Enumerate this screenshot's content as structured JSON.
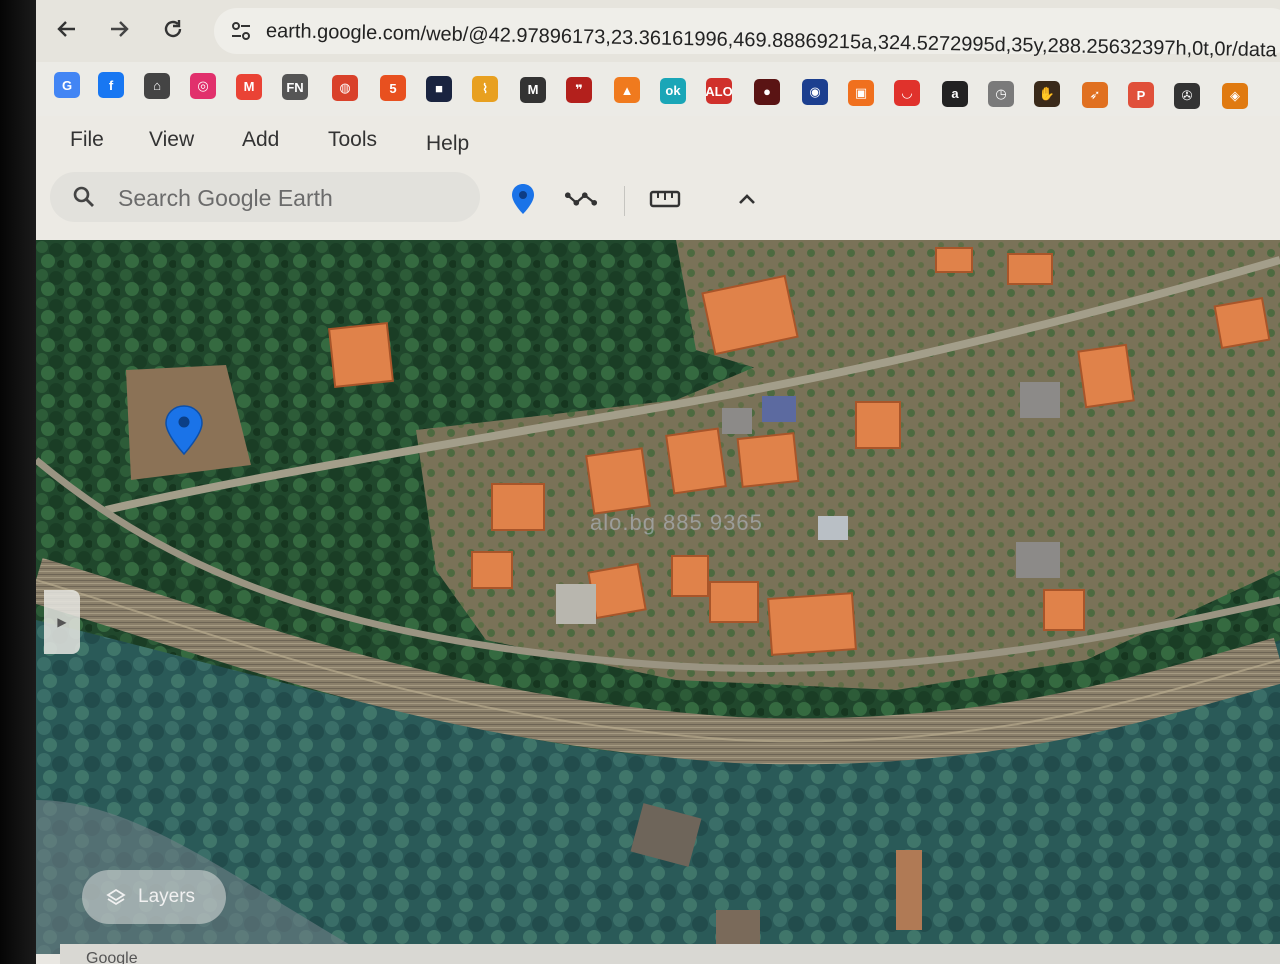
{
  "browser": {
    "url": "earth.google.com/web/@42.97896173,23.36161996,469.88869215a,324.5272995d,35y,288.25632397h,0t,0r/data",
    "nav": {
      "back_icon": "arrow-left-icon",
      "forward_icon": "arrow-right-icon",
      "reload_icon": "reload-icon"
    },
    "bookmarks": [
      {
        "name": "google",
        "glyph": "G",
        "color": "#4285f4"
      },
      {
        "name": "facebook",
        "glyph": "f",
        "color": "#1877f2"
      },
      {
        "name": "home",
        "glyph": "⌂",
        "color": "#444444"
      },
      {
        "name": "instagram",
        "glyph": "◎",
        "color": "#e1306c"
      },
      {
        "name": "gmail",
        "glyph": "M",
        "color": "#ea4335"
      },
      {
        "name": "fn",
        "glyph": "FN",
        "color": "#555555"
      },
      {
        "name": "globe",
        "glyph": "◍",
        "color": "#d9412a"
      },
      {
        "name": "five",
        "glyph": "5",
        "color": "#e8501f"
      },
      {
        "name": "dark-app",
        "glyph": "■",
        "color": "#1a2440"
      },
      {
        "name": "pulse",
        "glyph": "⌇",
        "color": "#e8a020"
      },
      {
        "name": "m-logo",
        "glyph": "M",
        "color": "#333333"
      },
      {
        "name": "quotes",
        "glyph": "❞",
        "color": "#b3201c"
      },
      {
        "name": "orange-shape",
        "glyph": "▲",
        "color": "#f07a1e"
      },
      {
        "name": "teal-app",
        "glyph": "ok",
        "color": "#1aa6b7"
      },
      {
        "name": "red-text",
        "glyph": "ALO",
        "color": "#d0302b"
      },
      {
        "name": "dark-circle",
        "glyph": "●",
        "color": "#5a1414"
      },
      {
        "name": "target",
        "glyph": "◉",
        "color": "#1c3f8f"
      },
      {
        "name": "orange-box",
        "glyph": "▣",
        "color": "#f0701e"
      },
      {
        "name": "red-bag",
        "glyph": "◡",
        "color": "#e0322c"
      },
      {
        "name": "amazon",
        "glyph": "a",
        "color": "#222222"
      },
      {
        "name": "clock-app",
        "glyph": "◷",
        "color": "#7a7a7a"
      },
      {
        "name": "hand",
        "glyph": "✋",
        "color": "#3a2a1a"
      },
      {
        "name": "arrow-app",
        "glyph": "➶",
        "color": "#e07020"
      },
      {
        "name": "p-app",
        "glyph": "P",
        "color": "#e0503a"
      },
      {
        "name": "mercedes",
        "glyph": "✇",
        "color": "#333333"
      },
      {
        "name": "orange-round",
        "glyph": "◈",
        "color": "#e07a10"
      }
    ]
  },
  "earth": {
    "menu": [
      "File",
      "View",
      "Add",
      "Tools",
      "Help"
    ],
    "search": {
      "placeholder": "Search Google Earth"
    },
    "tools": {
      "placemark_icon": "placemark-icon",
      "path_icon": "path-icon",
      "measure_icon": "ruler-icon",
      "collapse_icon": "chevron-up-icon"
    },
    "layers_label": "Layers",
    "watermark": "alo.bg 885 9365",
    "footer_text": "Google",
    "colors": {
      "pin": "#1a73e8",
      "roof": "#e0824a",
      "forest": "#1e4a2e"
    }
  }
}
